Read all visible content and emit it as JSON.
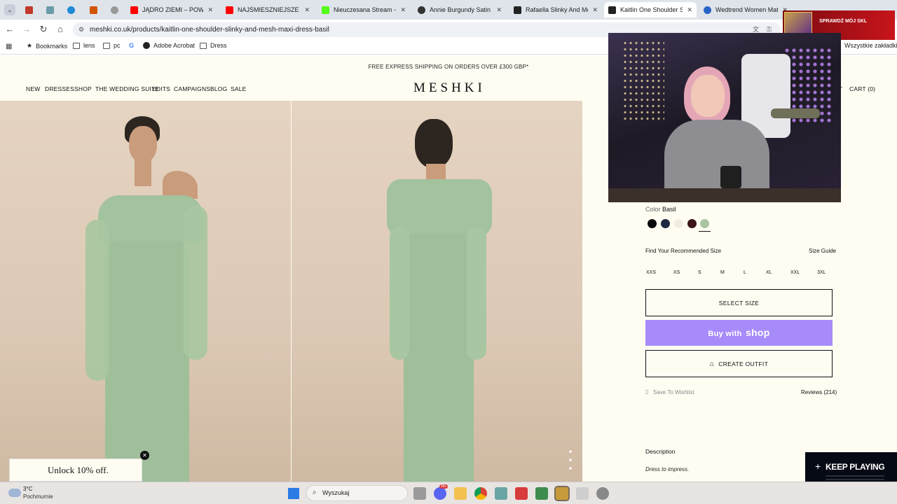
{
  "browser": {
    "tabs": [
      {
        "label": "",
        "color": "#c0392b"
      },
      {
        "label": "",
        "color": "#6b9aa8"
      },
      {
        "label": "",
        "color": "#1f8ad6"
      },
      {
        "label": "",
        "color": "#d35400"
      },
      {
        "label": "",
        "color": "#999999"
      },
      {
        "label": "JĄDRO ZIEMI – POWAŻN",
        "color": "#ff0000"
      },
      {
        "label": "NAJŚMIESZNIEJSZE MOM",
        "color": "#ff0000"
      },
      {
        "label": "Nieuczesana Stream - W",
        "color": "#53fc18"
      },
      {
        "label": "Annie Burgundy Satin Bo",
        "color": "#333333"
      },
      {
        "label": "Rafaella Slinky And Mes",
        "color": "#222222"
      },
      {
        "label": "Kaitlin One Shoulder Slin",
        "color": "#222222"
      },
      {
        "label": "Wedtrend Women Matc",
        "color": "#2a64c8"
      }
    ],
    "url": "meshki.co.uk/products/kaitlin-one-shoulder-slinky-and-mesh-maxi-dress-basil",
    "bookmarks": [
      "Bookmarks",
      "lens",
      "pc",
      "",
      "Adobe Acrobat",
      "Dress"
    ],
    "all_bookmarks": "Wszystkie zakładki"
  },
  "page": {
    "shipping": "FREE EXPRESS SHIPPING ON ORDERS OVER £300 GBP*",
    "nav": [
      "NEW",
      "DRESSES",
      "SHOP",
      "THE WEDDING SUITE",
      "EDITS",
      "CAMPAIGNS",
      "BLOG",
      "SALE"
    ],
    "logo": "MESHKI",
    "account": "T",
    "cart": "CART (0)",
    "color_label": "Color",
    "color_value": "Basil",
    "swatches": [
      "#0b0b0b",
      "#1f2741",
      "#f3ece0",
      "#3b1518",
      "#a8c5a0"
    ],
    "find_size": "Find Your Recommended Size",
    "size_guide": "Size Guide",
    "sizes": [
      "XXS",
      "XS",
      "S",
      "M",
      "L",
      "XL",
      "XXL",
      "3XL"
    ],
    "select_size": "SELECT SIZE",
    "buy_with": "Buy with",
    "shop": "shop",
    "create_outfit": "CREATE OUTFIT",
    "wishlist": "Save To Wishlist",
    "reviews": "Reviews (214)",
    "description": "Description",
    "description_text": "Dress to impress.",
    "unlock": "Unlock 10% off."
  },
  "overlay": {
    "sponsor": "SPRAWDŹ MÓJ SKL",
    "keep": "KEEP PLAYING"
  },
  "taskbar": {
    "temp": "3°C",
    "weather": "Pochmurnie",
    "search": "Wyszukaj",
    "badge": "99+"
  },
  "colors": {
    "buy_button": "#a78bfa",
    "page_bg": "#fffdf2",
    "dress": "#9fbf9a"
  }
}
